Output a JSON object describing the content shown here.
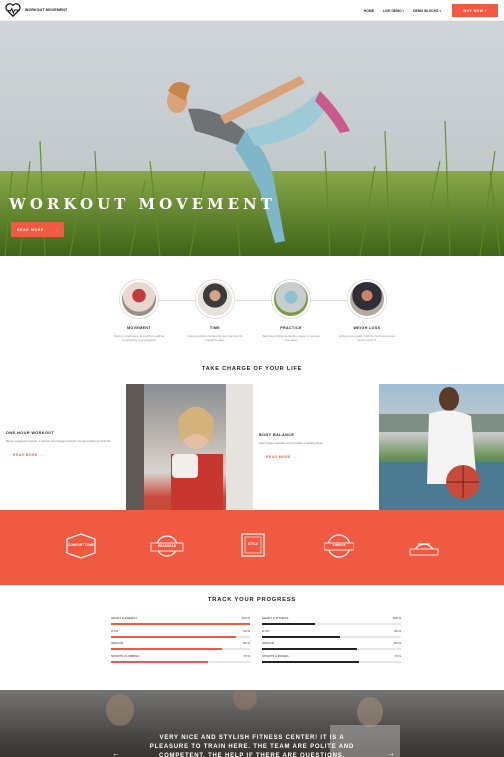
{
  "nav": {
    "brand": "WORKOUT MOVEMENT",
    "links": [
      "HOME",
      "LIVE DEMO",
      "DEMO BLOCKS"
    ],
    "buy_label": "BUY NOW"
  },
  "hero": {
    "title": "WORKOUT MOVEMENT",
    "button_label": "READ MORE"
  },
  "steps": [
    {
      "title": "MOVEMENT",
      "text": "Start by small steps, and with you will be surprised by your progress!"
    },
    {
      "title": "TIME",
      "text": "Give sixty-thirty minutes for your training. It's enough to start."
    },
    {
      "title": "PRACTICE",
      "text": "Take two or three workouts a week to maintain your level."
    },
    {
      "title": "WEIGH LOSS",
      "text": "Achieve your goals. It will be hard sometimes, but it's worth it!"
    }
  ],
  "charge_title": "TAKE CHARGE OF YOUR LIFE",
  "features": [
    {
      "title": "ONE-HOUR WORKOUT",
      "text": "Being engaged in sports, a person can change himself, his personality and his life.",
      "more": "READ MORE"
    },
    {
      "title": "BODY BALANCE",
      "text": "Sport helps maintain and provides a healthy sleep.",
      "more": "READ MORE"
    }
  ],
  "brands": [
    "COMFORT ZONE",
    "BEARHEAD",
    "STYLE",
    "CAMERAS",
    "cupcake"
  ],
  "progress": {
    "title": "TRACK YOUR PROGRESS",
    "left": [
      {
        "label": "HEART & ENERGY",
        "value": "100 %",
        "pct": 100
      },
      {
        "label": "GYM",
        "value": "90 %",
        "pct": 90
      },
      {
        "label": "INDOOR",
        "value": "80 %",
        "pct": 80
      },
      {
        "label": "SPORTS CLUBBING",
        "value": "70 %",
        "pct": 70
      }
    ],
    "right": [
      {
        "label": "HEART & FITNESS",
        "value": "100 %",
        "pct": 38
      },
      {
        "label": "GYM",
        "value": "90 %",
        "pct": 56
      },
      {
        "label": "INDOOR",
        "value": "80 %",
        "pct": 68
      },
      {
        "label": "SPORTS & BONES",
        "value": "70 %",
        "pct": 70
      }
    ]
  },
  "testimonial": {
    "text": "VERY NICE AND STYLISH FITNESS CENTER! IT IS A PLEASURE TO TRAIN HERE. THE TEAM ARE POLITE AND COMPETENT. THE HELP IF THERE ARE QUESTIONS."
  },
  "colors": {
    "accent": "#f05a42",
    "dark": "#222222"
  }
}
